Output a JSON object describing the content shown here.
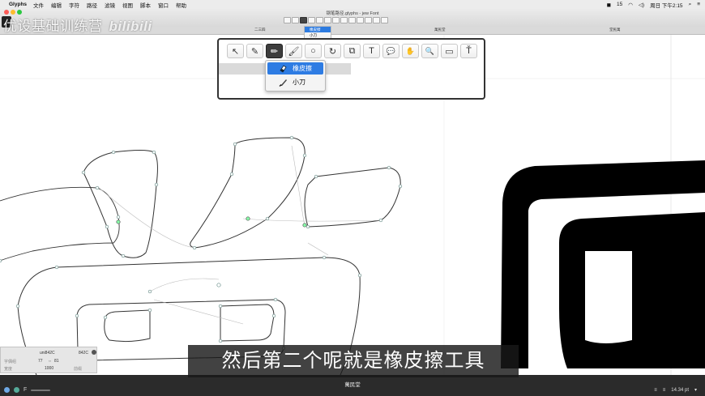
{
  "menubar": {
    "app_name": "Glyphs",
    "items": [
      "文件",
      "编辑",
      "字符",
      "路径",
      "滤镜",
      "视图",
      "脚本",
      "窗口",
      "帮助"
    ],
    "battery": "15",
    "datetime": "周日 下午2:15"
  },
  "window": {
    "title": "钢笔路径.glyphs - jew Font",
    "tabs": [
      "二三四",
      "萬民堂",
      "堂民萬"
    ],
    "mini_popup_items": [
      "橡皮擦",
      "小刀"
    ]
  },
  "watermark": {
    "text": "优设基础训练营",
    "logo": "bilibili"
  },
  "toolbar": {
    "tools": [
      {
        "icon": "select-arrow-icon",
        "glyph": "↖"
      },
      {
        "icon": "draw-icon",
        "glyph": "✎"
      },
      {
        "icon": "pencil-icon",
        "glyph": "✏"
      },
      {
        "icon": "brush-icon",
        "glyph": "🖌"
      },
      {
        "icon": "circle-shape-icon",
        "glyph": "○"
      },
      {
        "icon": "rotate-icon",
        "glyph": "↻"
      },
      {
        "icon": "scale-icon",
        "glyph": "⧉"
      },
      {
        "icon": "text-icon",
        "glyph": "T"
      },
      {
        "icon": "annotation-icon",
        "glyph": "💬"
      },
      {
        "icon": "hand-icon",
        "glyph": "✋"
      },
      {
        "icon": "zoom-icon",
        "glyph": "🔍"
      },
      {
        "icon": "measure-icon",
        "glyph": "▭"
      },
      {
        "icon": "type-icon",
        "glyph": "Ť"
      }
    ],
    "popup": [
      {
        "label": "橡皮擦",
        "icon": "eraser-icon",
        "highlighted": true
      },
      {
        "label": "小刀",
        "icon": "knife-icon",
        "highlighted": false
      }
    ]
  },
  "info_panel": {
    "glyph_name": "uni842C",
    "unicode": "842C",
    "x": "77",
    "y": "81",
    "width": "1000",
    "labels": [
      "字偶组",
      "宽度",
      "前缀"
    ]
  },
  "subtitle": "然后第二个呢就是橡皮擦工具",
  "bottombar": {
    "preview_text": "萬民堂",
    "zoom": "14.34 pt"
  },
  "colors": {
    "accent": "#2e7ce3",
    "canvas": "#ffffff",
    "glyph_fill": "#000000"
  }
}
